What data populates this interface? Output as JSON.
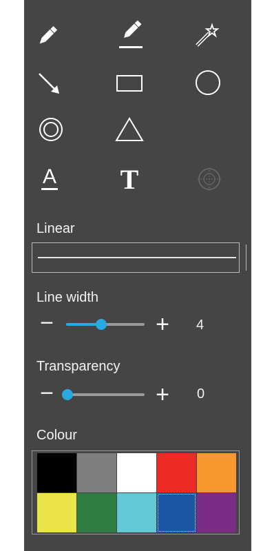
{
  "tools": [
    {
      "name": "pencil-tool",
      "icon": "pencil-icon"
    },
    {
      "name": "highlighter-tool",
      "icon": "highlighter-pencil-icon"
    },
    {
      "name": "magic-wand-tool",
      "icon": "magic-wand-icon"
    },
    {
      "name": "arrow-tool",
      "icon": "arrow-icon"
    },
    {
      "name": "rectangle-tool",
      "icon": "rectangle-icon"
    },
    {
      "name": "circle-tool",
      "icon": "circle-icon"
    },
    {
      "name": "concentric-circle-tool",
      "icon": "concentric-circles-icon"
    },
    {
      "name": "triangle-tool",
      "icon": "triangle-icon"
    },
    {
      "name": "text-underline-tool",
      "icon": "text-underline-icon"
    },
    {
      "name": "text-tool",
      "icon": "text-T-icon"
    },
    {
      "name": "crosshair-tool",
      "icon": "crosshair-icon",
      "disabled": true
    }
  ],
  "line_style": {
    "label": "Linear",
    "selected": "solid"
  },
  "line_width": {
    "label": "Line width",
    "minus": "−",
    "plus": "+",
    "value": "4",
    "level": 0.45
  },
  "transparency": {
    "label": "Transparency",
    "minus": "−",
    "plus": "+",
    "value": "0",
    "level": 0.0
  },
  "colour": {
    "label": "Colour",
    "swatches": [
      "#000000",
      "#7f7f7f",
      "#ffffff",
      "#ee2a24",
      "#f7982f",
      "#ebe34a",
      "#2f7d43",
      "#63c8d6",
      "#1d55a5",
      "#7b2c84"
    ],
    "selected_index": 8
  },
  "theme": {
    "panel_bg": "#454545",
    "accent": "#2aa8e0"
  }
}
